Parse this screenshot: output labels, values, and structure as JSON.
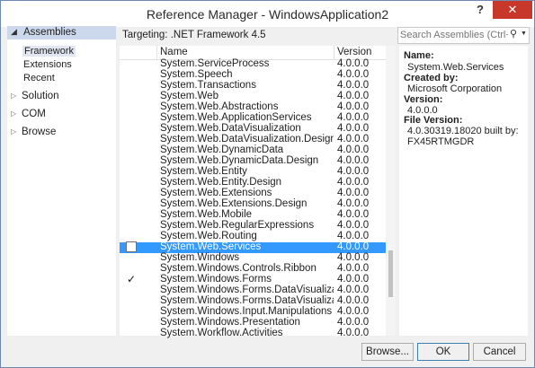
{
  "window": {
    "title": "Reference Manager - WindowsApplication2",
    "help": "?",
    "close": "✕"
  },
  "nav": {
    "assemblies": "Assemblies",
    "subitems": [
      "Framework",
      "Extensions",
      "Recent"
    ],
    "groups": [
      "Solution",
      "COM",
      "Browse"
    ]
  },
  "targeting": "Targeting: .NET Framework 4.5",
  "list": {
    "headers": {
      "name": "Name",
      "version": "Version"
    },
    "rows": [
      {
        "name": "System.ServiceProcess",
        "version": "4.0.0.0",
        "checked": false,
        "selected": false
      },
      {
        "name": "System.Speech",
        "version": "4.0.0.0",
        "checked": false,
        "selected": false
      },
      {
        "name": "System.Transactions",
        "version": "4.0.0.0",
        "checked": false,
        "selected": false
      },
      {
        "name": "System.Web",
        "version": "4.0.0.0",
        "checked": false,
        "selected": false
      },
      {
        "name": "System.Web.Abstractions",
        "version": "4.0.0.0",
        "checked": false,
        "selected": false
      },
      {
        "name": "System.Web.ApplicationServices",
        "version": "4.0.0.0",
        "checked": false,
        "selected": false
      },
      {
        "name": "System.Web.DataVisualization",
        "version": "4.0.0.0",
        "checked": false,
        "selected": false
      },
      {
        "name": "System.Web.DataVisualization.Design",
        "version": "4.0.0.0",
        "checked": false,
        "selected": false
      },
      {
        "name": "System.Web.DynamicData",
        "version": "4.0.0.0",
        "checked": false,
        "selected": false
      },
      {
        "name": "System.Web.DynamicData.Design",
        "version": "4.0.0.0",
        "checked": false,
        "selected": false
      },
      {
        "name": "System.Web.Entity",
        "version": "4.0.0.0",
        "checked": false,
        "selected": false
      },
      {
        "name": "System.Web.Entity.Design",
        "version": "4.0.0.0",
        "checked": false,
        "selected": false
      },
      {
        "name": "System.Web.Extensions",
        "version": "4.0.0.0",
        "checked": false,
        "selected": false
      },
      {
        "name": "System.Web.Extensions.Design",
        "version": "4.0.0.0",
        "checked": false,
        "selected": false
      },
      {
        "name": "System.Web.Mobile",
        "version": "4.0.0.0",
        "checked": false,
        "selected": false
      },
      {
        "name": "System.Web.RegularExpressions",
        "version": "4.0.0.0",
        "checked": false,
        "selected": false
      },
      {
        "name": "System.Web.Routing",
        "version": "4.0.0.0",
        "checked": false,
        "selected": false
      },
      {
        "name": "System.Web.Services",
        "version": "4.0.0.0",
        "checked": false,
        "selected": true
      },
      {
        "name": "System.Windows",
        "version": "4.0.0.0",
        "checked": false,
        "selected": false
      },
      {
        "name": "System.Windows.Controls.Ribbon",
        "version": "4.0.0.0",
        "checked": false,
        "selected": false
      },
      {
        "name": "System.Windows.Forms",
        "version": "4.0.0.0",
        "checked": true,
        "selected": false
      },
      {
        "name": "System.Windows.Forms.DataVisualization",
        "version": "4.0.0.0",
        "checked": false,
        "selected": false
      },
      {
        "name": "System.Windows.Forms.DataVisualization.Desi...",
        "version": "4.0.0.0",
        "checked": false,
        "selected": false
      },
      {
        "name": "System.Windows.Input.Manipulations",
        "version": "4.0.0.0",
        "checked": false,
        "selected": false
      },
      {
        "name": "System.Windows.Presentation",
        "version": "4.0.0.0",
        "checked": false,
        "selected": false
      },
      {
        "name": "System.Workflow.Activities",
        "version": "4.0.0.0",
        "checked": false,
        "selected": false
      }
    ]
  },
  "search": {
    "placeholder": "Search Assemblies (Ctrl+E)"
  },
  "details": {
    "name_label": "Name:",
    "name_value": "System.Web.Services",
    "createdby_label": "Created by:",
    "createdby_value": "Microsoft Corporation",
    "version_label": "Version:",
    "version_value": "4.0.0.0",
    "fileversion_label": "File Version:",
    "fileversion_value1": "4.0.30319.18020 built by:",
    "fileversion_value2": "FX45RTMGDR"
  },
  "buttons": {
    "browse": "Browse...",
    "ok": "OK",
    "cancel": "Cancel"
  }
}
